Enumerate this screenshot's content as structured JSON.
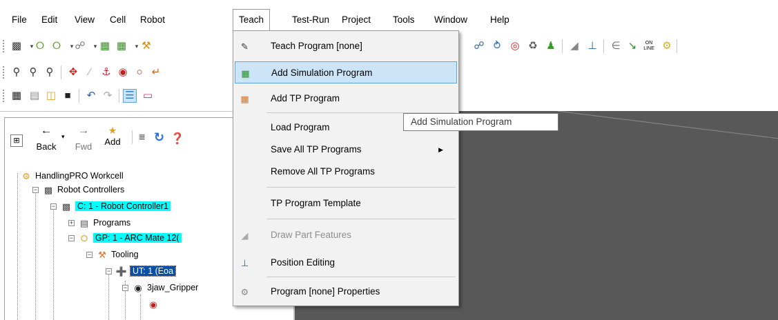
{
  "menubar": {
    "items": [
      "File",
      "Edit",
      "View",
      "Cell",
      "Robot",
      "Teach",
      "Test-Run",
      "Project",
      "Tools",
      "Window",
      "Help"
    ],
    "active": "Teach"
  },
  "teach_menu": {
    "items": [
      {
        "label": "Teach Program [none]",
        "icon": "teach-program-icon"
      },
      {
        "label": "Add Simulation Program",
        "icon": "add-simulation-program-icon",
        "highlighted": true
      },
      {
        "label": "Add TP Program",
        "icon": "add-tp-program-icon"
      },
      {
        "label": "Load Program"
      },
      {
        "label": "Save All TP Programs",
        "submenu": true
      },
      {
        "label": "Remove All TP Programs"
      },
      {
        "label": "TP Program Template"
      },
      {
        "label": "Draw Part Features",
        "icon": "draw-part-features-icon",
        "disabled": true
      },
      {
        "label": "Position Editing",
        "icon": "position-editing-icon"
      },
      {
        "label": "Program [none] Properties",
        "icon": "properties-gear-icon"
      }
    ]
  },
  "tooltip": "Add Simulation Program",
  "nav": {
    "back": "Back",
    "fwd": "Fwd",
    "add": "Add"
  },
  "toolbar_right": {
    "online_label_1": "ON",
    "online_label_2": "LINE"
  },
  "tree": {
    "workcell": "HandlingPRO Workcell",
    "robot_controllers": "Robot Controllers",
    "controller": "C: 1 - Robot Controller1",
    "programs": "Programs",
    "group": "GP: 1 - ARC Mate 12(",
    "tooling": "Tooling",
    "ut": "UT: 1  (Eoa",
    "gripper": "3jaw_Gripper"
  },
  "colors": {
    "highlight_cyan": "#00ffff",
    "selection_blue": "#0a4fa8",
    "menu_hover": "#cce4f7",
    "viewport_bg": "#585858"
  }
}
